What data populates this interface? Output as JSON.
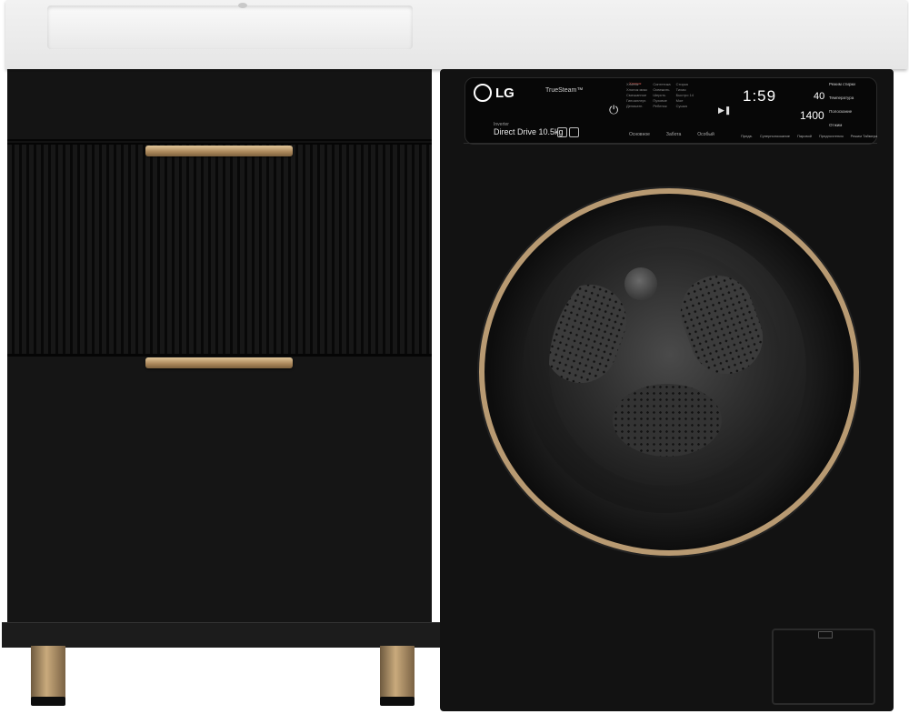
{
  "brand": {
    "name": "LG"
  },
  "panel": {
    "truesteam": "TrueSteam™",
    "inverter": "Inverter",
    "model": "Direct Drive 10.5kg",
    "red_tag": "Хлопок",
    "programs": [
      "Хлопок",
      "Синтетика",
      "Стирка",
      "Хлопок микс",
      "Освежить",
      "Тихая",
      "Смешанное",
      "Шерсть",
      "Быстро 14",
      "Гипоаллерг.",
      "Пуховое",
      "Мое",
      "Деликатн.",
      "Ребенок",
      "Сушка"
    ],
    "tabs": [
      "Основное",
      "Забота",
      "Особый"
    ],
    "display_main": "1:59",
    "temperature": "40",
    "spin": "1400",
    "right_labels": [
      "Режим стирки",
      "Температура",
      "Полоскание",
      "Отжим"
    ],
    "bottom_labels": [
      "Предв.",
      "Суперполоскание",
      "Паровой",
      "Предпочтения",
      "Режим Таймера"
    ]
  },
  "colors": {
    "cabinet": "#121212",
    "accent_gold": "#b89a72",
    "countertop": "#eeeeee"
  }
}
